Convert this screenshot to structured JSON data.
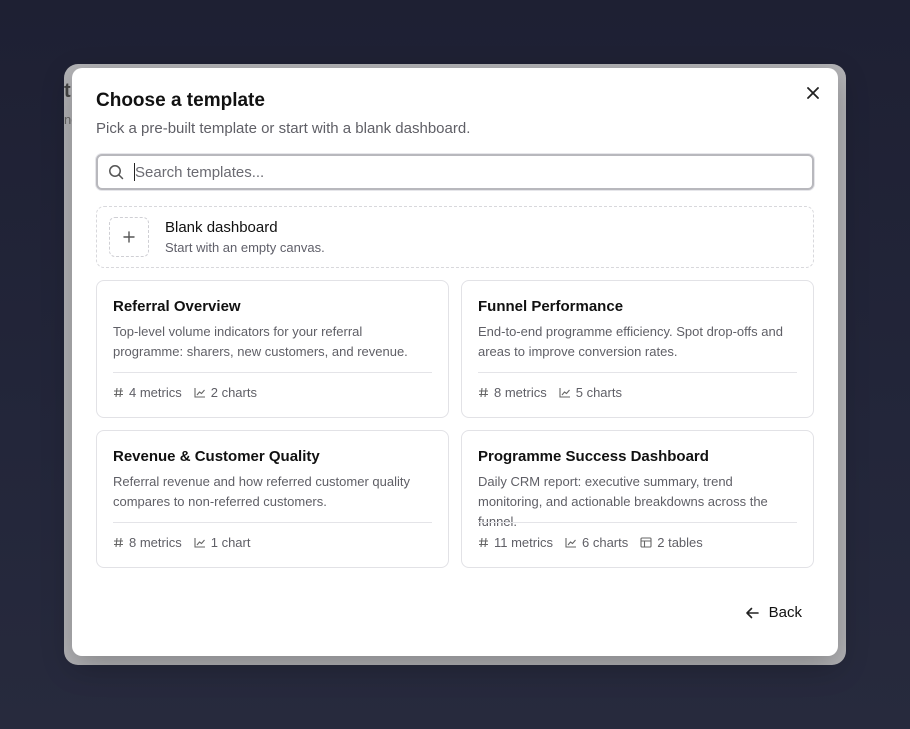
{
  "background": {
    "title_fragment": "ti",
    "subtitle_fragment": "nc"
  },
  "modal": {
    "title": "Choose a template",
    "subtitle": "Pick a pre-built template or start with a blank dashboard.",
    "close_icon": "close-icon"
  },
  "search": {
    "placeholder": "Search templates...",
    "value": "",
    "icon": "search-icon"
  },
  "blank": {
    "title": "Blank dashboard",
    "description": "Start with an empty canvas.",
    "icon": "plus-icon"
  },
  "templates": [
    {
      "title": "Referral Overview",
      "description": "Top-level volume indicators for your referral programme: sharers, new customers, and revenue.",
      "metrics": "4 metrics",
      "charts": "2 charts"
    },
    {
      "title": "Funnel Performance",
      "description": "End-to-end programme efficiency. Spot drop-offs and areas to improve conversion rates.",
      "metrics": "8 metrics",
      "charts": "5 charts"
    },
    {
      "title": "Revenue & Customer Quality",
      "description": "Referral revenue and how referred customer quality compares to non-referred customers.",
      "metrics": "8 metrics",
      "charts": "1 chart"
    },
    {
      "title": "Programme Success Dashboard",
      "description": "Daily CRM report: executive summary, trend monitoring, and actionable breakdowns across the funnel.",
      "metrics": "11 metrics",
      "charts": "6 charts",
      "tables": "2 tables"
    }
  ],
  "footer": {
    "back_label": "Back"
  },
  "colors": {
    "page_background": "#23263a",
    "modal_background": "#ffffff",
    "muted_text": "#5f5f66",
    "border": "#e2e2e6"
  }
}
